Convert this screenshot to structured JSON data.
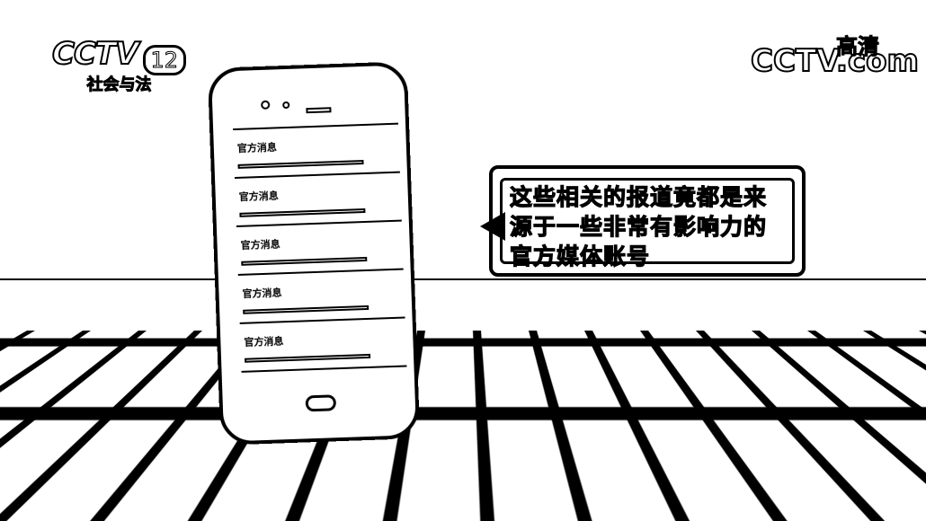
{
  "logos": {
    "channel": {
      "brand": "CCTV",
      "number": "12",
      "name": "社会与法"
    },
    "website": {
      "brand": "CCTV.com",
      "badge": "高清"
    }
  },
  "phone": {
    "items": [
      {
        "title": "官方消息"
      },
      {
        "title": "官方消息"
      },
      {
        "title": "官方消息"
      },
      {
        "title": "官方消息"
      },
      {
        "title": "官方消息"
      }
    ]
  },
  "caption": {
    "lines": [
      "这些相关的报道竟都是来",
      "源于一些非常有影响力的",
      "官方媒体账号"
    ]
  },
  "colors": {
    "foreground": "#000000",
    "background": "#ffffff"
  }
}
